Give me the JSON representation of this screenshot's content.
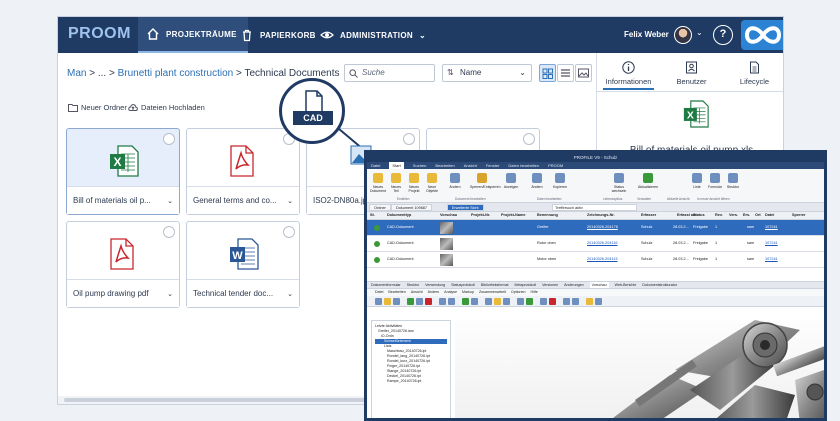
{
  "header": {
    "logo": "PROOM",
    "nav": [
      {
        "label": "PROJEKTRÄUME",
        "icon": "home-icon",
        "active": true
      },
      {
        "label": "PAPIERKORB",
        "icon": "trash-icon",
        "active": false
      },
      {
        "label": "ADMINISTRATION",
        "icon": "eye-icon",
        "active": false
      }
    ],
    "user_name": "Felix Weber",
    "help_glyph": "?",
    "brand_color": "#2c83d3"
  },
  "breadcrumb": {
    "root": "Man",
    "sep": ">",
    "ellipsis": "...",
    "project": "Brunetti plant construction",
    "current": "Technical Documents"
  },
  "toolbar": {
    "search_placeholder": "Suche",
    "sort_label": "Name",
    "new_folder": "Neuer Ordner",
    "upload": "Dateien Hochladen"
  },
  "files": [
    {
      "name": "Bill of materials oil p...",
      "type": "excel",
      "selected": true
    },
    {
      "name": "General terms and co...",
      "type": "pdf",
      "selected": false
    },
    {
      "name": "ISO2-DN80a.jpg",
      "type": "image",
      "selected": false
    },
    {
      "name": "",
      "type": "blank",
      "selected": false
    },
    {
      "name": "Oil pump drawing pdf",
      "type": "pdf",
      "selected": false
    },
    {
      "name": "Technical tender doc...",
      "type": "word",
      "selected": false
    }
  ],
  "details": {
    "tabs": [
      "Informationen",
      "Benutzer",
      "Lifecycle"
    ],
    "active_tab": "Informationen",
    "file_name": "Bill of materials oil pump.xls"
  },
  "callout": {
    "label": "CAD"
  },
  "profile_window": {
    "title": "PROFILE V9 - Schulz",
    "menu": [
      "Datei",
      "Start",
      "Suchen",
      "Bearbeiten",
      "Ansicht",
      "Fenster",
      "Daten bearbeiten",
      "PROOM"
    ],
    "active_menu": "Start",
    "ribbon": [
      {
        "label": "Neues Dokument",
        "color": "#e9b93a"
      },
      {
        "label": "Neues Teil",
        "color": "#e9b93a"
      },
      {
        "label": "Neues Projekt",
        "color": "#e9b93a"
      },
      {
        "label": "Neue Objekte",
        "color": "#e9b93a"
      },
      {
        "label": "Ändern",
        "color": "#6f8fbf"
      },
      {
        "label": "Sperren/Entsperren",
        "color": "#d9a32c"
      },
      {
        "label": "Anzeigen",
        "color": "#6f8fbf"
      },
      {
        "label": "Ändern",
        "color": "#6f8fbf"
      },
      {
        "label": "Kopieren",
        "color": "#6f8fbf"
      },
      {
        "label": "Status wechseln",
        "color": "#6f8fbf"
      },
      {
        "label": "Aktualisieren",
        "color": "#3a9a3a"
      },
      {
        "label": "Liste",
        "color": "#6f8fbf"
      },
      {
        "label": "Formular",
        "color": "#6f8fbf"
      },
      {
        "label": "Struktur",
        "color": "#6f8fbf"
      }
    ],
    "ribbon_groups": [
      "Erstellen",
      "Dokument bearbeiten",
      "Daten bearbeiten",
      "Lebenszyklus",
      "Verwalten",
      "Aktuelle Ansicht",
      "In neuer Ansicht öffnen"
    ],
    "tabs": [
      "Ordner",
      "Dokument 109687",
      "Erweiterte Sicht"
    ],
    "filter_placeholder": "Treffersuch aktiv",
    "columns": [
      "St.",
      "Dokumenttyp",
      "Vorschau",
      "Projekt-Nr.",
      "Projekt-Name",
      "Benennung",
      "Zeichnungs-Nr.",
      "Erfasser",
      "Erfasst am",
      "Status",
      "Rev.",
      "Vers.",
      "Ers.",
      "Ort",
      "Datei",
      "Sperrer"
    ],
    "rows": [
      {
        "type": "CAD-Dokument",
        "name": "Greifer",
        "number": "20140326-204176",
        "user": "Schulz",
        "date": "28.03.2...",
        "status": "Freigabe",
        "rev": "1",
        "loc": "sam",
        "file": "107241",
        "selected": true
      },
      {
        "type": "CAD-Dokument",
        "name": "Rotor oben",
        "number": "20140326-204116",
        "user": "Schulz",
        "date": "28.03.2...",
        "status": "Freigabe",
        "rev": "1",
        "loc": "sam",
        "file": "107241",
        "selected": false
      },
      {
        "type": "CAD-Dokument",
        "name": "Motor oben",
        "number": "20140326-204113",
        "user": "Schulz",
        "date": "28.03.2...",
        "status": "Freigabe",
        "rev": "1",
        "loc": "sam",
        "file": "107241",
        "selected": false
      }
    ],
    "lower_tabs": [
      "Dokumentformular",
      "Struktur",
      "Verwendung",
      "Statusprotokoll",
      "Bibliotheksformat",
      "Metaprotokoll",
      "Versionen",
      "Änderungen",
      "Vorschau",
      "Web-Berichte",
      "Dokumentstrukturator"
    ],
    "active_lower_tab": "Vorschau",
    "viewer_menu": [
      "Datei",
      "Bearbeiten",
      "Ansicht",
      "Ändern",
      "Analyse",
      "Markup",
      "Zusammenarbeit",
      "Optionen",
      "Hilfe"
    ],
    "tree": [
      "Letzte Aktivitäten",
      "Greifer_20140726.iam",
      "iO-Ordn",
      "Schweißelement",
      "Lists",
      "Maschbau_20140726.ipt",
      "Rondel_lang_20140726.ipt",
      "Rondel_kurz_20140726.ipt",
      "Finger_20140726.ipt",
      "Stange_20140726.ipt",
      "Deckel_20140726.ipt",
      "Rampe_20140726.ipt"
    ]
  }
}
